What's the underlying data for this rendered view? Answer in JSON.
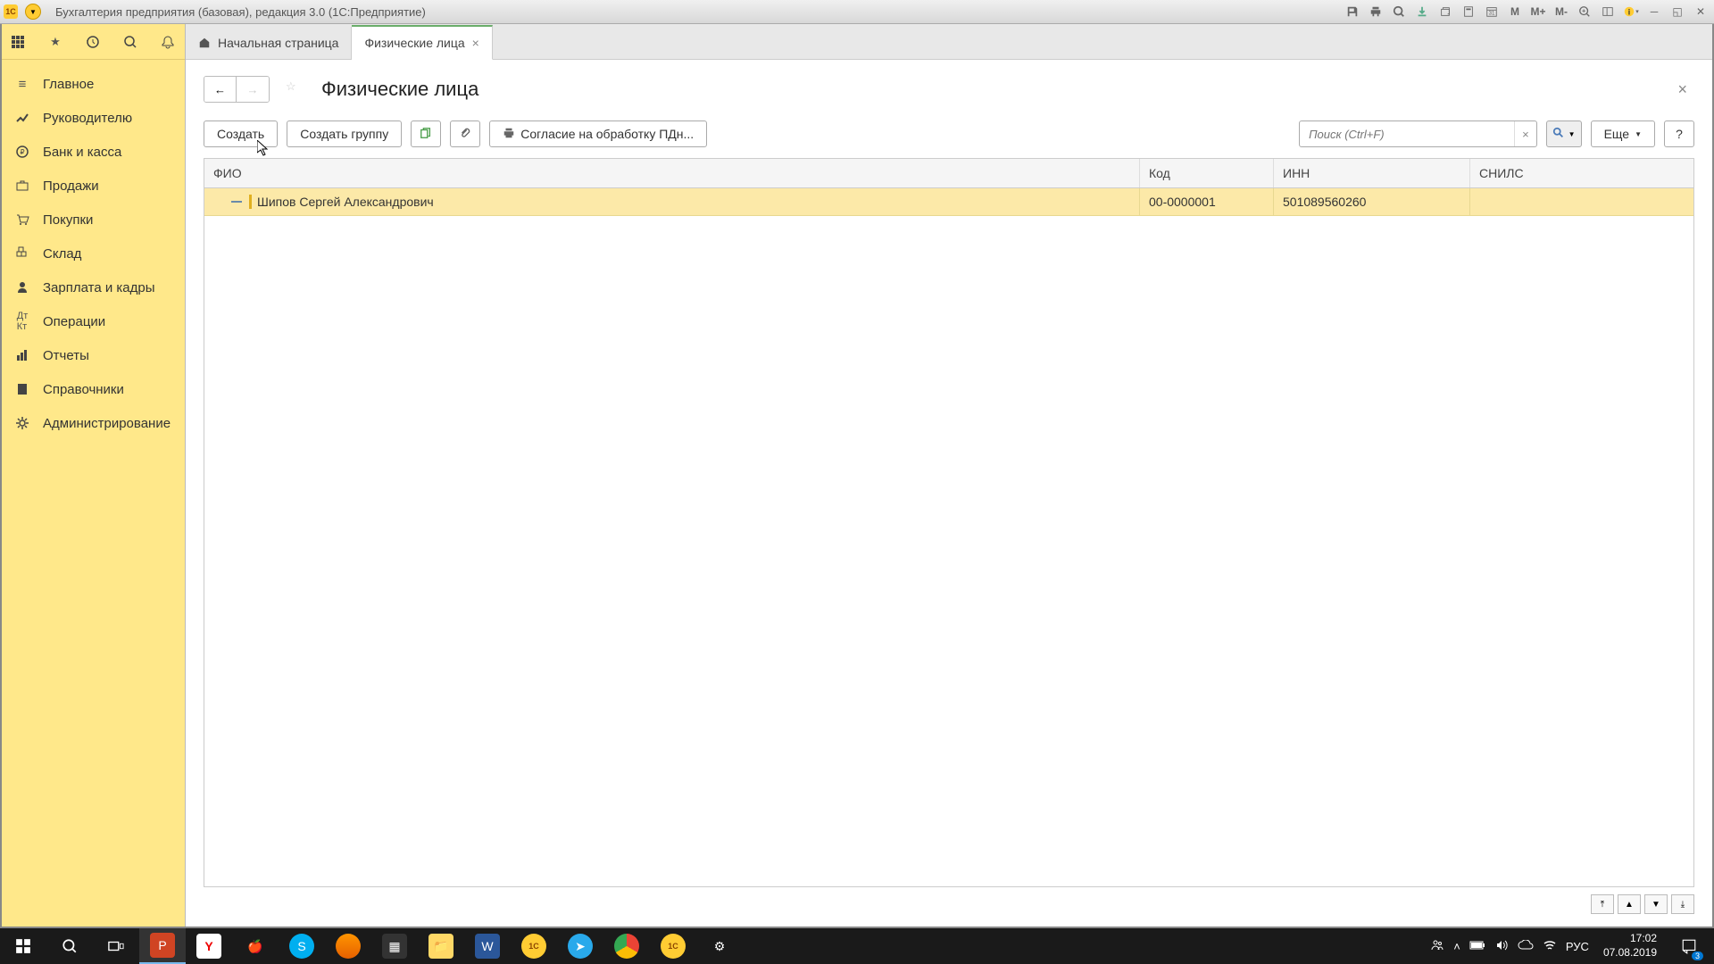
{
  "titlebar": {
    "app_icon": "1C",
    "title": "Бухгалтерия предприятия (базовая), редакция 3.0  (1С:Предприятие)",
    "mem_buttons": [
      "M",
      "M+",
      "M-"
    ]
  },
  "toolbar_icons": [
    "apps",
    "star",
    "history",
    "search",
    "bell"
  ],
  "sidebar": {
    "items": [
      {
        "icon": "menu",
        "label": "Главное"
      },
      {
        "icon": "trend",
        "label": "Руководителю"
      },
      {
        "icon": "bank",
        "label": "Банк и касса"
      },
      {
        "icon": "cart",
        "label": "Продажи"
      },
      {
        "icon": "cart2",
        "label": "Покупки"
      },
      {
        "icon": "warehouse",
        "label": "Склад"
      },
      {
        "icon": "person",
        "label": "Зарплата и кадры"
      },
      {
        "icon": "ops",
        "label": "Операции"
      },
      {
        "icon": "chart",
        "label": "Отчеты"
      },
      {
        "icon": "book",
        "label": "Справочники"
      },
      {
        "icon": "gear",
        "label": "Администрирование"
      }
    ]
  },
  "tabs": [
    {
      "icon": "home",
      "label": "Начальная страница",
      "active": false
    },
    {
      "icon": "",
      "label": "Физические лица",
      "active": true,
      "closable": true
    }
  ],
  "page": {
    "title": "Физические лица"
  },
  "commands": {
    "create": "Создать",
    "create_group": "Создать группу",
    "consent": "Согласие на обработку ПДн...",
    "more": "Еще",
    "help": "?"
  },
  "search": {
    "placeholder": "Поиск (Ctrl+F)"
  },
  "table": {
    "headers": {
      "fio": "ФИО",
      "code": "Код",
      "inn": "ИНН",
      "snils": "СНИЛС"
    },
    "rows": [
      {
        "fio": "Шипов Сергей Александрович",
        "code": "00-0000001",
        "inn": "501089560260",
        "snils": ""
      }
    ]
  },
  "taskbar": {
    "lang": "РУС",
    "time": "17:02",
    "date": "07.08.2019",
    "notif_count": "3"
  }
}
